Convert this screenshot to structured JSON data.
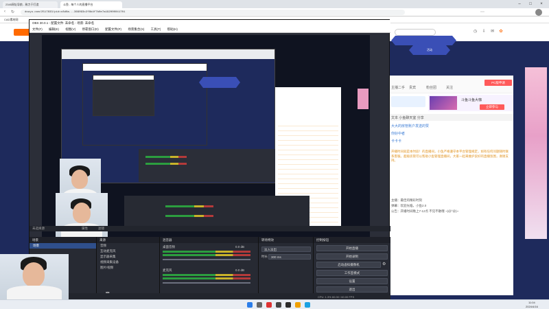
{
  "browser": {
    "tabs": [
      "2345网址导航 - 致力于打造",
      "斗鱼 - 每个人的直播平台"
    ],
    "url": "douyu.com/2517833/pid=c8d0a...369093c2f8b4f7b0e7a192000041701",
    "bookmarks": "CAD素材网"
  },
  "douyu": {
    "nav_tags": [
      "",
      "",
      "活动"
    ],
    "right_panel": {
      "tabs": [
        "主播二手",
        "贵宾",
        "粉丝团",
        "关注",
        "举报"
      ],
      "follow_btn": "PC版申请",
      "lottery_title": "斗鱼斗鱼大咖",
      "lottery_btn": "立即参与",
      "chat_header": "文本  小鱼聊天室  分享",
      "chat_items": [
        "大大的房管账户发送的赞",
        "你好中者",
        "卡卡卡"
      ],
      "notice_text": "开播时间就是本时段！的直播间，小鱼严格遵守本平台管理规定，如有任何问题随时联系客服。超级房管可以帮助小鱼管理直播间，大家一起来维护良好的直播氛围，谢谢支持。",
      "footer_lines": [
        "主播：最佳的精彩时刻",
        "弹幕：欢迎光临，小鱼2.0",
        "公告：开播时间晚上7-12点 不见不散哦 ~(@°@)~"
      ]
    }
  },
  "obs": {
    "title": "OBS 30.0.1 - 配置文件: 未命名 - 场景: 未命名",
    "menu": [
      "文件(F)",
      "编辑(E)",
      "视图(V)",
      "停靠窗口(D)",
      "配置文件(P)",
      "场景集合(S)",
      "工具(T)",
      "帮助(H)"
    ],
    "scenes_header": "场景",
    "scenes": [
      "场景"
    ],
    "sources_header": "来源",
    "sources": [
      "音频",
      "互动麦克风",
      "显示器采集",
      "视频采集设备",
      "图片/视频"
    ],
    "mixer_header": "混音器",
    "mixer_channels": [
      {
        "name": "桌面音频",
        "db": "0.0 dB"
      },
      {
        "name": "麦克风",
        "db": "0.0 dB"
      }
    ],
    "transitions_header": "转场特效",
    "transition_value": "淡入淡出",
    "duration_label": "时长",
    "duration_value": "300 ms",
    "controls_header": "控制按钮",
    "controls": [
      "开始直播",
      "开始录制",
      "启动虚拟摄像机",
      "工作室模式",
      "设置",
      "退出"
    ],
    "status": "CPU: 1.3%  60.00 / 60.00 FPS",
    "no_source": "未选择源",
    "props": "属性",
    "filters": "滤镜"
  },
  "taskbar": {
    "time": "11:04",
    "date": "2024/4/16"
  }
}
